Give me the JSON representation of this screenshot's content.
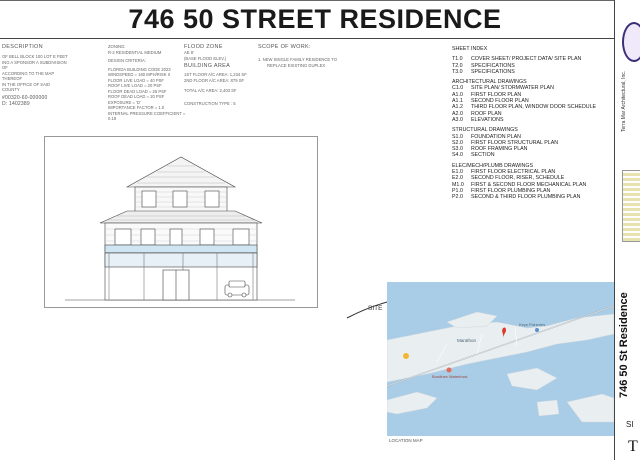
{
  "title": "746 50 STREET RESIDENCE",
  "project_desc": {
    "heading": "DESCRIPTION",
    "lines": [
      "OF BELL BLOCK 100 LOT E FEET",
      "ING A SPONSOR A SUBDIVISION OF",
      "ACCORDING TO THE MAP THEREOF",
      "IN THE OFFICE OF SAID",
      "COUNTY"
    ],
    "parcel": "#00320-60-000000",
    "id": "D: 1402389"
  },
  "zoning": {
    "label1": "ZONING:",
    "value1": "R-2 RESIDENTIAL MEDIUM",
    "label2": "DESIGN CRITERIA:",
    "criteria": [
      "FLORIDA BUILDING CODE 2023",
      "WINDSPEED = 160 MPH/RISK II",
      "FLOOR LIVE LOAD = 40 PSF",
      "ROOF LIVE LOAD = 20 PSF",
      "FLOOR DEAD LOAD = 25 PSF",
      "ROOF DEAD LOAD = 20 PSF",
      "EXPOSURE = 'D'",
      "IMPORTANCE FACTOR = 1.0",
      "INTERNAL PRESSURE COEFFICIENT = 0.18"
    ]
  },
  "flood": {
    "heading": "FLOOD ZONE",
    "lines": [
      "AE 9'",
      "(BASE FLOOD ELEV.)"
    ],
    "building_heading": "BUILDING AREA",
    "areas": [
      "1ST FLOOR A/C AREA: 1,234 SF",
      "2ND FLOOR A/C AREA: 879 SF",
      "",
      "TOTAL A/C AREA: 2,403 SF"
    ],
    "construction": "CONSTRUCTION TYPE : 5"
  },
  "scope": {
    "heading": "SCOPE OF WORK:",
    "lines": [
      "1.   NEW SINGLE FAMILY RESIDENCE TO",
      "REPLACE EXISTING DUPLEX"
    ]
  },
  "sheet_index": {
    "heading": "SHEET INDEX",
    "groups": [
      {
        "name": "",
        "items": [
          [
            "T1.0",
            "COVER SHEET/ PROJECT DATA/ SITE PLAN"
          ],
          [
            "T2.0",
            "SPECIFICATIONS"
          ],
          [
            "T3.0",
            "SPECIFICATIONS"
          ]
        ]
      },
      {
        "name": "ARCHITECTURAL DRAWINGS",
        "items": [
          [
            "C1.0",
            "SITE PLAN/ STORMWATER PLAN"
          ],
          [
            "A1.0",
            "FIRST FLOOR PLAN"
          ],
          [
            "A1.1",
            "SECOND FLOOR PLAN"
          ],
          [
            "A1.2",
            "THIRD FLOOR PLAN, WINDOW DOOR SCHEDULE"
          ],
          [
            "A2.0",
            "ROOF PLAN"
          ],
          [
            "A3.0",
            "ELEVATIONS"
          ]
        ]
      },
      {
        "name": "STRUCTURAL DRAWINGS",
        "items": [
          [
            "S1.0",
            "FOUNDATION PLAN"
          ],
          [
            "S2.0",
            "FIRST FLOOR STRUCTURAL PLAN"
          ],
          [
            "S3.0",
            "ROOF FRAMING PLAN"
          ],
          [
            "S4.0",
            "SECTION"
          ]
        ]
      },
      {
        "name": "ELEC/MECH/PLUMB DRAWINGS",
        "items": [
          [
            "E1.0",
            "FIRST FLOOR ELECTRICAL PLAN"
          ],
          [
            "E2.0",
            "SECOND FLOOR, RISER, SCHEDULE"
          ],
          [
            "M1.0",
            "FIRST & SECOND FLOOR MECHANICAL PLAN"
          ],
          [
            "P1.0",
            "FIRST FLOOR PLUMBING PLAN"
          ],
          [
            "P2.0",
            "SECOND & THIRD FLOOR PLUMBING PLAN"
          ]
        ]
      }
    ]
  },
  "site_label": "SITE",
  "map_caption": "LOCATION MAP",
  "map_labels": [
    "Marathon",
    "Keys Fisheries",
    "Burdines Waterfront"
  ],
  "title_block": {
    "firm": "Terra Mar Architectural, Inc.",
    "project": "746 50 St Residence",
    "sheet_label": "SI",
    "sheet_no": "T"
  },
  "colors": {
    "water": "#a9cde6",
    "land": "#e8ecef",
    "road": "#ffffff",
    "accent_purple": "#3b2f7a",
    "pin": "#d93a2b"
  }
}
